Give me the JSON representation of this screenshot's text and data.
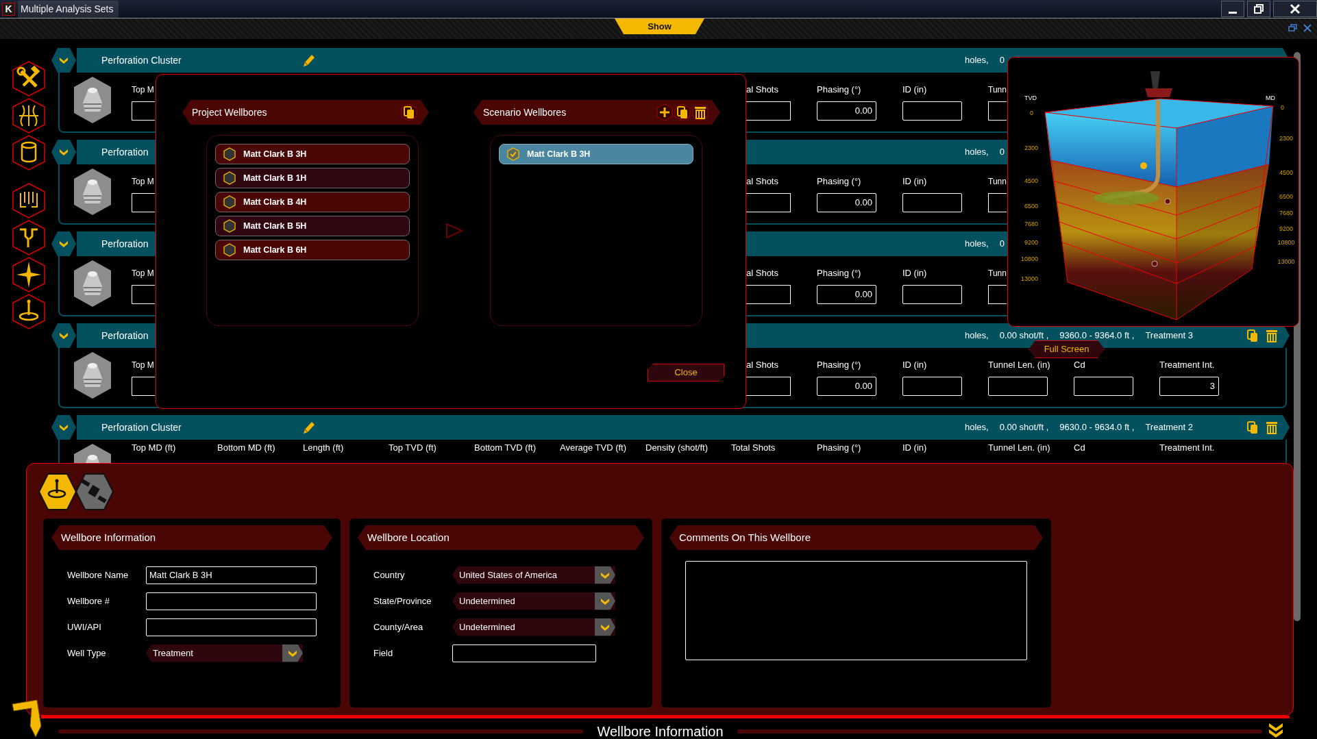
{
  "window": {
    "logo": "K",
    "title": "Multiple Analysis Sets"
  },
  "toolbar": {
    "tab": "Show"
  },
  "clusters": [
    {
      "title": "Perforation Cluster",
      "edit_icon": true,
      "summary": [
        "holes,",
        "0"
      ],
      "fields_left": [
        {
          "kind": "field",
          "label": "Top M",
          "cut_right": true
        }
      ],
      "fields_right": [
        {
          "kind": "field",
          "label": "al Shots",
          "cut_left": true
        },
        {
          "kind": "field",
          "label": "Phasing (°)",
          "value": "0.00"
        },
        {
          "kind": "field",
          "label": "ID (in)"
        },
        {
          "kind": "field",
          "label": "Tunn",
          "cut_right": true
        }
      ]
    },
    {
      "title": "Perforation",
      "edit_icon": false,
      "summary": [
        "holes,",
        "0"
      ],
      "fields_left": [
        {
          "kind": "field",
          "label": "Top M",
          "cut_right": true
        }
      ],
      "fields_right": [
        {
          "kind": "field",
          "label": "al Shots",
          "cut_left": true
        },
        {
          "kind": "field",
          "label": "Phasing (°)",
          "value": "0.00"
        },
        {
          "kind": "field",
          "label": "ID (in)"
        },
        {
          "kind": "field",
          "label": "Tunn",
          "cut_right": true
        }
      ]
    },
    {
      "title": "Perforation",
      "edit_icon": false,
      "summary": [
        "holes,",
        "0"
      ],
      "fields_left": [
        {
          "kind": "field",
          "label": "Top M",
          "cut_right": true
        }
      ],
      "fields_right": [
        {
          "kind": "field",
          "label": "al Shots",
          "cut_left": true
        },
        {
          "kind": "field",
          "label": "Phasing (°)",
          "value": "0.00"
        },
        {
          "kind": "field",
          "label": "ID (in)"
        },
        {
          "kind": "field",
          "label": "Tunn",
          "cut_right": true
        }
      ]
    },
    {
      "title": "Perforation",
      "edit_icon": false,
      "summary": [
        "holes,",
        "0.00 shot/ft ,",
        "9360.0 - 9364.0 ft ,",
        "Treatment 3"
      ],
      "actions": [
        {
          "kind": "copy"
        },
        {
          "kind": "delete"
        }
      ],
      "fields_left": [
        {
          "kind": "field",
          "label": "Top M",
          "cut_right": true
        }
      ],
      "fields_right": [
        {
          "kind": "field",
          "label": "al Shots",
          "cut_left": true
        },
        {
          "kind": "field",
          "label": "Phasing (°)",
          "value": "0.00"
        },
        {
          "kind": "field",
          "label": "ID (in)"
        },
        {
          "kind": "field",
          "label": "Tunnel Len. (in)"
        },
        {
          "kind": "field",
          "label": "Cd"
        },
        {
          "kind": "field",
          "label": "Treatment Int.",
          "value": "3"
        }
      ]
    },
    {
      "title": "Perforation Cluster",
      "edit_icon": true,
      "summary": [
        "holes,",
        "0.00 shot/ft ,",
        "9630.0 - 9634.0 ft ,",
        "Treatment 2"
      ],
      "actions": [
        {
          "kind": "copy"
        },
        {
          "kind": "delete"
        }
      ],
      "fields_left": [
        {
          "kind": "label",
          "label": "Top MD (ft)"
        },
        {
          "kind": "label",
          "label": "Bottom MD (ft)"
        },
        {
          "kind": "label",
          "label": "Length (ft)"
        },
        {
          "kind": "label",
          "label": "Top TVD (ft)"
        },
        {
          "kind": "label",
          "label": "Bottom TVD (ft)"
        },
        {
          "kind": "label",
          "label": "Average TVD (ft)"
        },
        {
          "kind": "label",
          "label": "Density (shot/ft)"
        }
      ],
      "fields_right": [
        {
          "kind": "label",
          "label": "Total Shots"
        },
        {
          "kind": "label",
          "label": "Phasing (°)"
        },
        {
          "kind": "label",
          "label": "ID (in)"
        },
        {
          "kind": "label",
          "label": "Tunnel Len. (in)"
        },
        {
          "kind": "label",
          "label": "Cd"
        },
        {
          "kind": "label",
          "label": "Treatment Int."
        }
      ]
    }
  ],
  "wellbore_dialog": {
    "project": {
      "title": "Project Wellbores",
      "actions": [
        {
          "kind": "copy"
        }
      ],
      "items": [
        {
          "name": "Matt Clark B 3H",
          "checked": false
        },
        {
          "name": "Matt Clark B 1H",
          "checked": false
        },
        {
          "name": "Matt Clark B 4H",
          "checked": false
        },
        {
          "name": "Matt Clark B 5H",
          "checked": false
        },
        {
          "name": "Matt Clark B 6H",
          "checked": false
        }
      ]
    },
    "scenario": {
      "title": "Scenario Wellbores",
      "actions": [
        {
          "kind": "add"
        },
        {
          "kind": "copy"
        },
        {
          "kind": "delete"
        }
      ],
      "items": [
        {
          "name": "Matt Clark B 3H",
          "checked": true
        }
      ]
    },
    "close": "Close"
  },
  "model_view": {
    "left_axis": {
      "title": "TVD",
      "ticks": [
        "0",
        "2300",
        "4500",
        "6500",
        "7680",
        "9200",
        "10800",
        "13000"
      ]
    },
    "right_axis": {
      "title": "MD",
      "ticks": [
        "0",
        "2300",
        "4500",
        "6500",
        "7680",
        "9200",
        "10800",
        "13000"
      ]
    },
    "button": "Full Screen"
  },
  "details": {
    "tabs": [
      {
        "kind": "location",
        "selected": true
      },
      {
        "kind": "satellite",
        "selected": false
      }
    ],
    "sections": [
      {
        "kind": "form",
        "title": "Wellbore Information",
        "fields": [
          {
            "kind": "input",
            "label": "Wellbore Name",
            "value": "Matt Clark B 3H"
          },
          {
            "kind": "input",
            "label": "Wellbore #"
          },
          {
            "kind": "input",
            "label": "UWI/API"
          },
          {
            "kind": "select",
            "label": "Well Type",
            "value": "Treatment"
          }
        ]
      },
      {
        "kind": "form",
        "title": "Wellbore Location",
        "fields": [
          {
            "kind": "select",
            "label": "Country",
            "value": "United States of America"
          },
          {
            "kind": "select",
            "label": "State/Province",
            "value": "Undetermined"
          },
          {
            "kind": "select",
            "label": "County/Area",
            "value": "Undetermined"
          },
          {
            "kind": "input",
            "label": "Field"
          }
        ]
      },
      {
        "kind": "comments",
        "title": "Comments On This Wellbore"
      }
    ]
  },
  "footer": {
    "title": "Wellbore Information"
  }
}
